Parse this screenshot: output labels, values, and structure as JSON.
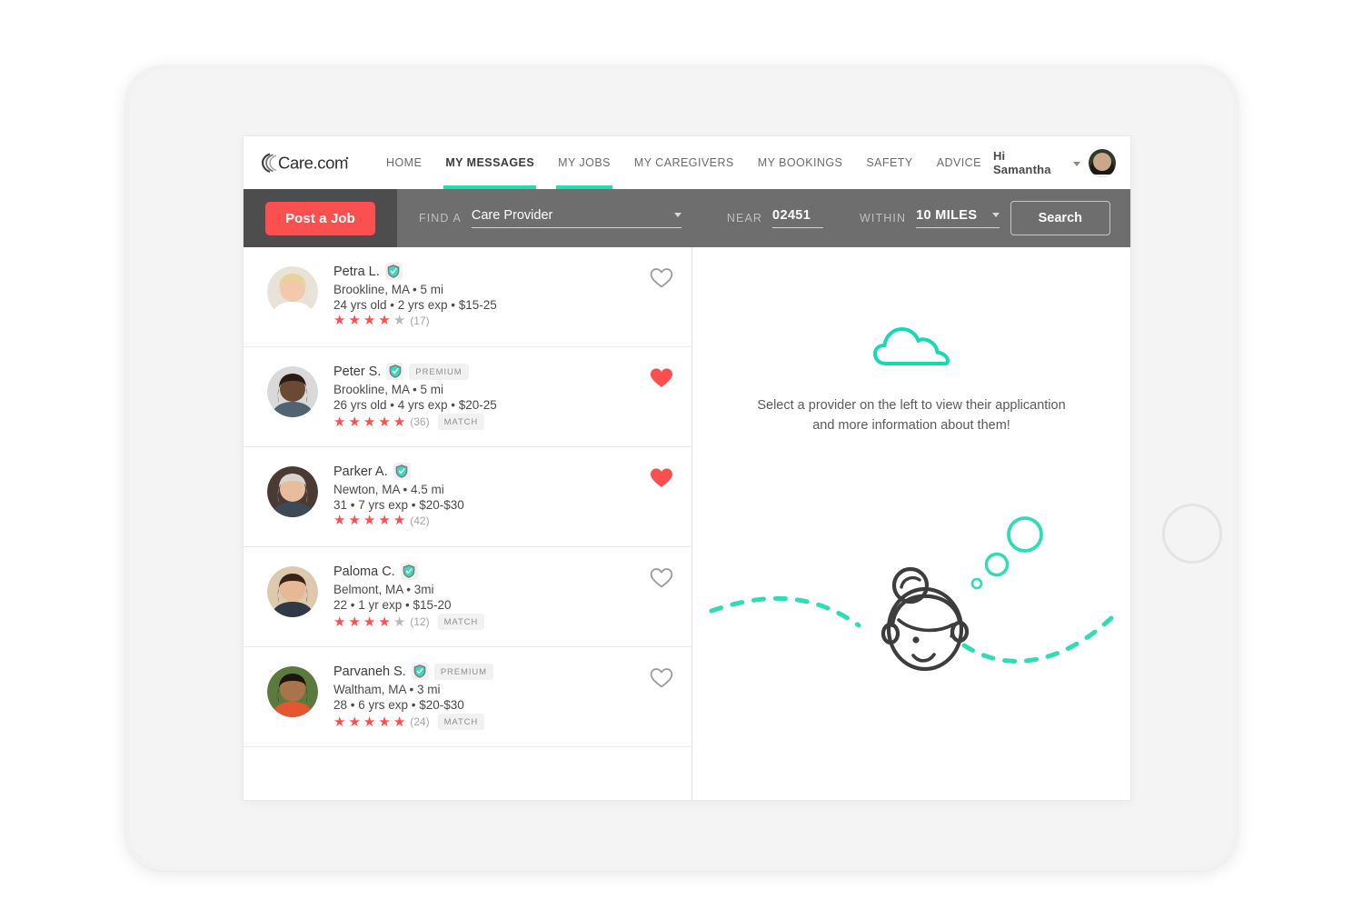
{
  "brand": {
    "logo_text": "Care.com",
    "accent_teal": "#23dcb0",
    "accent_red": "#fa5050",
    "nav_bar_dark": "#4d4d4d",
    "nav_bar_gray": "#6e6e6e"
  },
  "topnav": {
    "links": [
      {
        "label": "HOME",
        "active": false,
        "underlined": false
      },
      {
        "label": "MY MESSAGES",
        "active": true,
        "underlined": true
      },
      {
        "label": "MY JOBS",
        "active": false,
        "underlined": true
      },
      {
        "label": "MY CAREGIVERS",
        "active": false,
        "underlined": false
      },
      {
        "label": "MY BOOKINGS",
        "active": false,
        "underlined": false
      },
      {
        "label": "SAFETY",
        "active": false,
        "underlined": false
      },
      {
        "label": "ADVICE",
        "active": false,
        "underlined": false
      }
    ],
    "greeting": "Hi Samantha"
  },
  "searchbar": {
    "post_job_label": "Post a Job",
    "find_a_label": "FIND A",
    "find_a_value": "Care Provider",
    "near_label": "NEAR",
    "near_value": "02451",
    "within_label": "WITHIN",
    "within_value": "10 MILES",
    "search_label": "Search"
  },
  "providers": [
    {
      "name": "Petra L.",
      "verified": true,
      "premium": false,
      "location": "Brookline, MA  • 5 mi",
      "details": "24 yrs old  • 2 yrs exp  • $15-25",
      "stars_filled": 4,
      "stars_total": 5,
      "review_count": "(17)",
      "match": false,
      "favorited": false,
      "avatar": {
        "skin": "#f2c9ab",
        "hair": "#e8d49a",
        "bg": "#e9e2d8",
        "clothes": "#ffffff"
      }
    },
    {
      "name": "Peter S.",
      "verified": true,
      "premium": true,
      "premium_label": "PREMIUM",
      "location": "Brookline, MA  • 5 mi",
      "details": "26 yrs old  • 4 yrs exp  • $20-25",
      "stars_filled": 5,
      "stars_total": 5,
      "review_count": "(36)",
      "match": true,
      "match_label": "MATCH",
      "favorited": true,
      "avatar": {
        "skin": "#6b4a34",
        "hair": "#2a1d14",
        "bg": "#d9d9d9",
        "clothes": "#4f6373"
      }
    },
    {
      "name": "Parker A.",
      "verified": true,
      "premium": false,
      "location": "Newton, MA  • 4.5 mi",
      "details": "31  • 7 yrs exp  • $20-$30",
      "stars_filled": 5,
      "stars_total": 5,
      "review_count": "(42)",
      "match": false,
      "favorited": true,
      "avatar": {
        "skin": "#e8bd9d",
        "hair": "#d9d4cd",
        "bg": "#4b3a34",
        "clothes": "#3d4a56"
      }
    },
    {
      "name": "Paloma C.",
      "verified": true,
      "premium": false,
      "location": "Belmont, MA  • 3mi",
      "details": "22  • 1 yr exp • $15-20",
      "stars_filled": 4,
      "stars_total": 5,
      "review_count": "(12)",
      "match": true,
      "match_label": "MATCH",
      "favorited": false,
      "avatar": {
        "skin": "#e6b894",
        "hair": "#3a2418",
        "bg": "#ddc9ad",
        "clothes": "#2f3a46"
      }
    },
    {
      "name": "Parvaneh S.",
      "verified": true,
      "premium": true,
      "premium_label": "PREMIUM",
      "location": "Waltham, MA  • 3 mi",
      "details": "28  • 6 yrs exp  • $20-$30",
      "stars_filled": 5,
      "stars_total": 5,
      "review_count": "(24)",
      "match": true,
      "match_label": "MATCH",
      "favorited": false,
      "avatar": {
        "skin": "#a9734c",
        "hair": "#1e1410",
        "bg": "#5c7a3e",
        "clothes": "#e2572f"
      }
    }
  ],
  "detail_panel": {
    "empty_message_line1": "Select a provider on the left to view their applicantion",
    "empty_message_line2": "and more information about them!",
    "cloud_icon": "cloud-outline-icon",
    "illustration": "woman-face-dashed-path-illustration"
  },
  "icons": {
    "heart_filled": "heart-filled-icon",
    "heart_outline": "heart-outline-icon",
    "shield_verified": "shield-verified-icon",
    "chevron_down": "chevron-down-icon",
    "star": "star-icon"
  }
}
